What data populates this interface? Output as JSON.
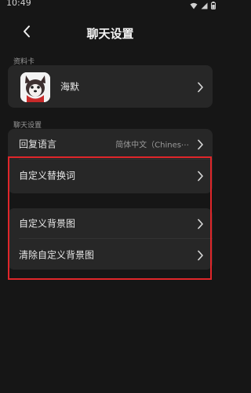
{
  "status_bar": {
    "time": "10:49"
  },
  "header": {
    "title": "聊天设置"
  },
  "profile_section": {
    "label": "资料卡",
    "name": "海默"
  },
  "chat_section": {
    "label": "聊天设置",
    "reply_language": {
      "label": "回复语言",
      "value": "简体中文（Chines⋯"
    }
  },
  "custom_replace": {
    "label": "自定义替换词"
  },
  "background": {
    "custom_label": "自定义背景图",
    "clear_label": "清除自定义背景图"
  },
  "colors": {
    "background": "#161616",
    "card": "#272727",
    "highlight": "#e0262a"
  }
}
